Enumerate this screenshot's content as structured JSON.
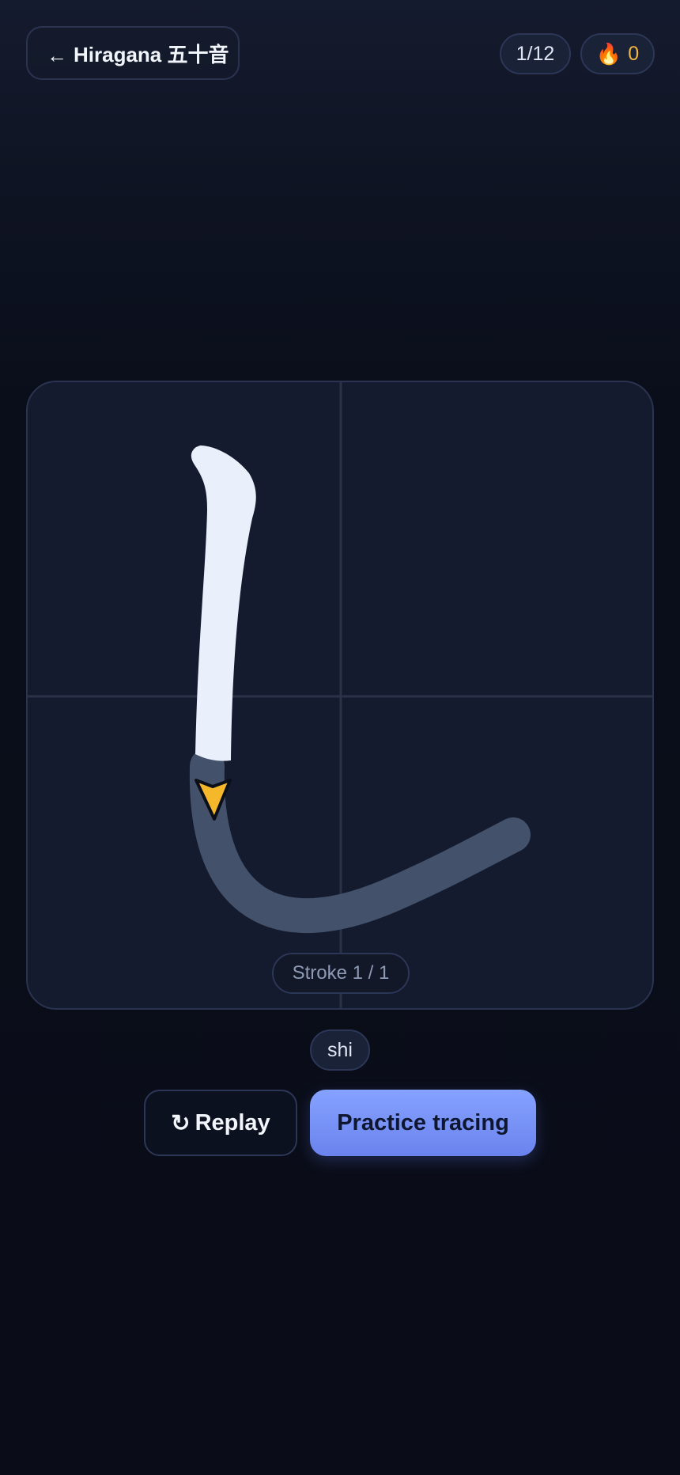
{
  "header": {
    "back_arrow": "←",
    "back_label": "Hiragana 五十音",
    "progress": "1/12",
    "streak_icon": "fire-icon",
    "streak_emoji": "🔥",
    "streak_count": "0"
  },
  "canvas": {
    "character": "し",
    "stroke_counter": "Stroke 1 / 1",
    "stroke_total": 1,
    "current_stroke": 1,
    "colors": {
      "card_bg": "#141b2e",
      "guide_line": "#2a3249",
      "stroke_remaining": "#44516a",
      "stroke_drawn": "#e9effb",
      "pen_marker": "#f5b82a"
    }
  },
  "romaji": "shi",
  "actions": {
    "replay_icon": "↻",
    "replay_label": "Replay",
    "practice_label": "Practice tracing"
  },
  "colors": {
    "accent": "#7b95fb",
    "streak": "#f2b640"
  }
}
